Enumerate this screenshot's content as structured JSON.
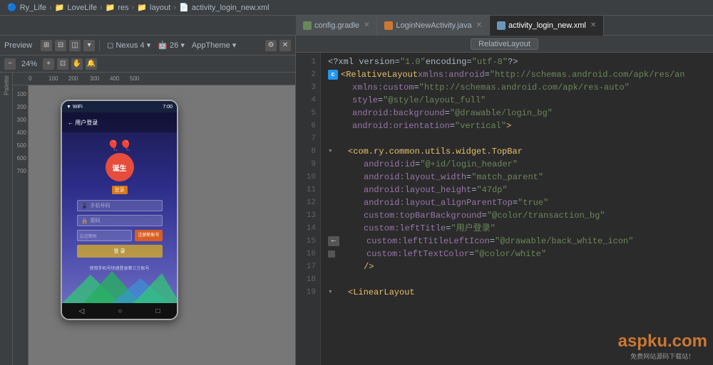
{
  "breadcrumb": {
    "items": [
      "Ry_Life",
      "LoveLife",
      "res",
      "layout",
      "activity_login_new.xml"
    ]
  },
  "tabs": [
    {
      "id": "config",
      "label": "config.gradle",
      "type": "gradle",
      "active": false
    },
    {
      "id": "login",
      "label": "LoginNewActivity.java",
      "type": "java",
      "active": false
    },
    {
      "id": "xml",
      "label": "activity_login_new.xml",
      "type": "xml",
      "active": true
    }
  ],
  "preview": {
    "label": "Preview",
    "device": "Nexus 4",
    "api": "26",
    "theme": "AppTheme",
    "zoom": "24%",
    "palette_label": "Palette"
  },
  "editor": {
    "title_tag": "RelativeLayout",
    "lines": [
      {
        "num": 1,
        "indent": 0,
        "content": "<?xml version=\"1.0\" encoding=\"utf-8\"?>"
      },
      {
        "num": 2,
        "indent": 0,
        "content": "<RelativeLayout xmlns:android=\"http://schemas.android.com/apk/res/an",
        "has_c": true
      },
      {
        "num": 3,
        "indent": 1,
        "content": "xmlns:custom=\"http://schemas.android.com/apk/res-auto\""
      },
      {
        "num": 4,
        "indent": 1,
        "content": "style=\"@style/layout_full\""
      },
      {
        "num": 5,
        "indent": 1,
        "content": "android:background=\"@drawable/login_bg\""
      },
      {
        "num": 6,
        "indent": 1,
        "content": "android:orientation=\"vertical\">"
      },
      {
        "num": 7,
        "indent": 0,
        "content": ""
      },
      {
        "num": 8,
        "indent": 1,
        "content": "<com.ry.common.utils.widget.TopBar",
        "has_fold": true
      },
      {
        "num": 9,
        "indent": 2,
        "content": "android:id=\"@+id/login_header\""
      },
      {
        "num": 10,
        "indent": 2,
        "content": "android:layout_width=\"match_parent\""
      },
      {
        "num": 11,
        "indent": 2,
        "content": "android:layout_height=\"47dp\""
      },
      {
        "num": 12,
        "indent": 2,
        "content": "android:layout_alignParentTop=\"true\""
      },
      {
        "num": 13,
        "indent": 2,
        "content": "custom:topBarBackground=\"@color/transaction_bg\""
      },
      {
        "num": 14,
        "indent": 2,
        "content": "custom:leftTitle=\"用户登录\""
      },
      {
        "num": 15,
        "indent": 2,
        "content": "custom:leftTitleLeftIcon=\"@drawable/back_white_icon\"",
        "has_arrow_left": true
      },
      {
        "num": 16,
        "indent": 2,
        "content": "custom:leftTextColor=\"@color/white\"",
        "has_square": true
      },
      {
        "num": 17,
        "indent": 2,
        "content": "/>"
      },
      {
        "num": 18,
        "indent": 0,
        "content": ""
      },
      {
        "num": 19,
        "indent": 1,
        "content": "<LinearLayout"
      }
    ]
  },
  "phone": {
    "status_time": "7:00",
    "logo_text": "诞生",
    "input_phone_placeholder": "手机号码",
    "input_pwd_placeholder": "密码",
    "btn_login_label": "忘记密码",
    "btn_register_label": "注册新账号",
    "bottom_text": "使用手机号快速登录第三方账号"
  },
  "watermark": {
    "main": "aspku.com",
    "sub": "免费网站源码下载站！"
  }
}
